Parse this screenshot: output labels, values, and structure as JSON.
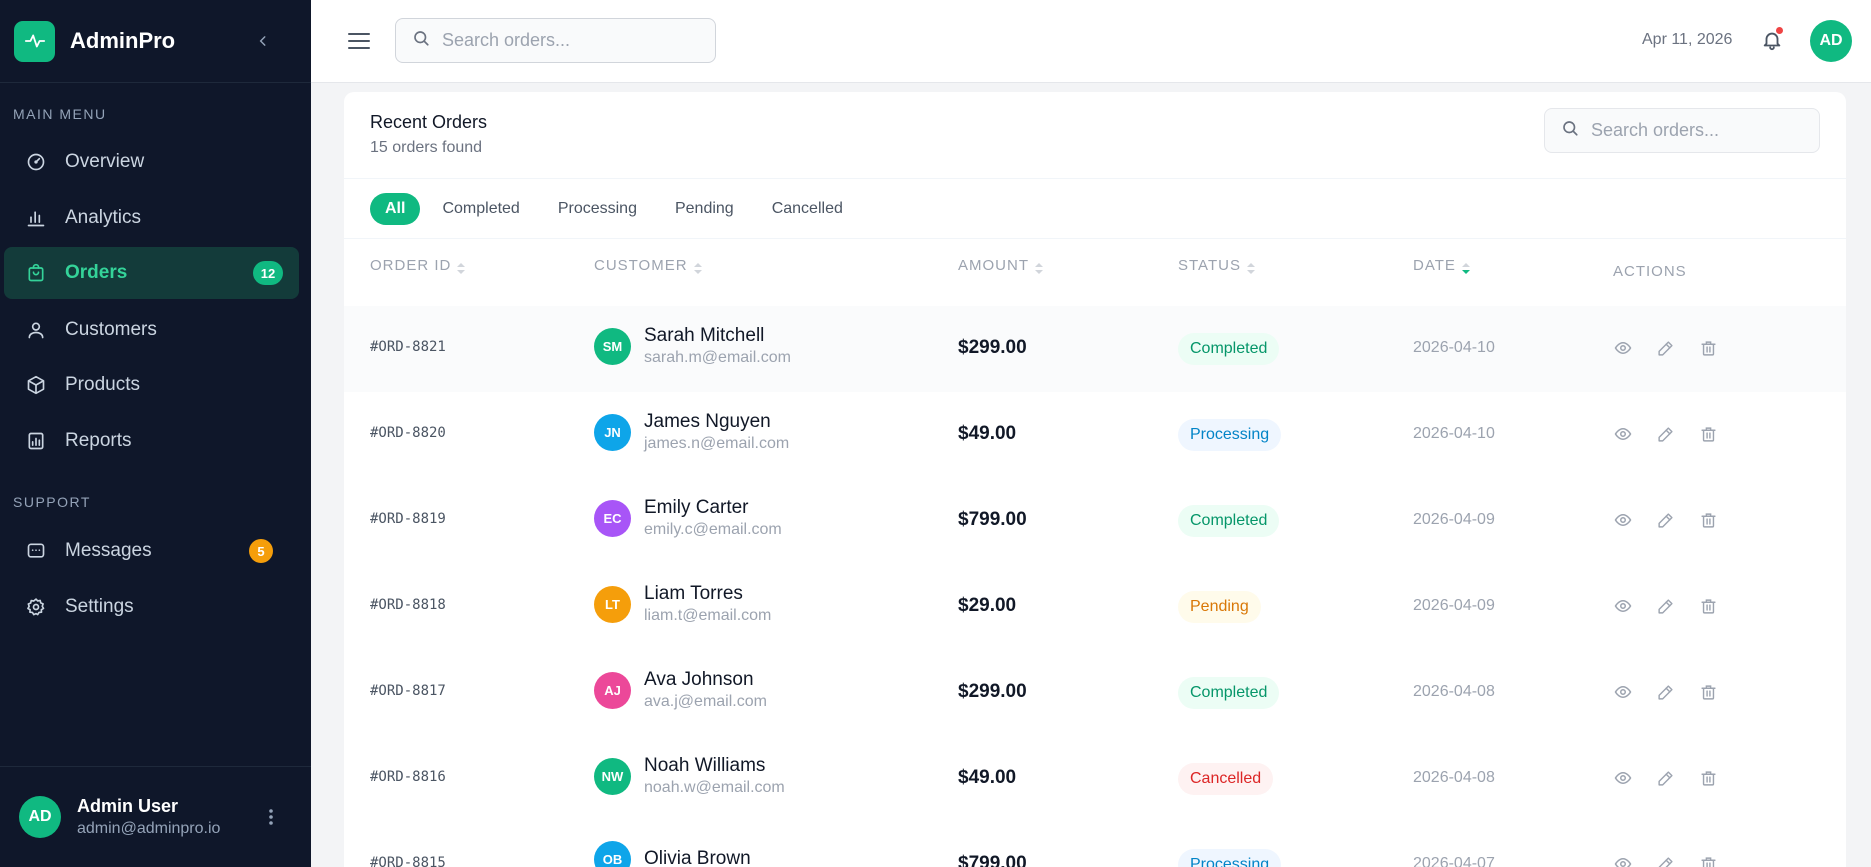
{
  "app": {
    "name": "AdminPro"
  },
  "sidebar": {
    "main_menu_label": "MAIN MENU",
    "support_label": "SUPPORT",
    "items": [
      {
        "label": "Overview",
        "icon": "dashboard-gauge-icon"
      },
      {
        "label": "Analytics",
        "icon": "bar-chart-icon"
      },
      {
        "label": "Orders",
        "icon": "shopping-bag-icon",
        "badge": "12",
        "active": true
      },
      {
        "label": "Customers",
        "icon": "user-icon"
      },
      {
        "label": "Products",
        "icon": "box-icon"
      },
      {
        "label": "Reports",
        "icon": "report-icon"
      }
    ],
    "support_items": [
      {
        "label": "Messages",
        "icon": "message-icon",
        "badge": "5"
      },
      {
        "label": "Settings",
        "icon": "gear-icon"
      }
    ],
    "user": {
      "initials": "AD",
      "name": "Admin User",
      "email": "admin@adminpro.io"
    }
  },
  "topbar": {
    "search_placeholder": "Search orders...",
    "date": "Apr 11, 2026",
    "avatar_initials": "AD"
  },
  "orders": {
    "title": "Recent Orders",
    "subtitle": "15 orders found",
    "search_placeholder": "Search orders...",
    "filters": [
      "All",
      "Completed",
      "Processing",
      "Pending",
      "Cancelled"
    ],
    "active_filter": "All",
    "columns": [
      "ORDER ID",
      "CUSTOMER",
      "AMOUNT",
      "STATUS",
      "DATE",
      "ACTIONS"
    ],
    "rows": [
      {
        "id": "#ORD-8821",
        "initials": "SM",
        "name": "Sarah Mitchell",
        "email": "sarah.m@email.com",
        "amount": "$299.00",
        "status": "Completed",
        "date": "2026-04-10",
        "avatar_color": "#10b981"
      },
      {
        "id": "#ORD-8820",
        "initials": "JN",
        "name": "James Nguyen",
        "email": "james.n@email.com",
        "amount": "$49.00",
        "status": "Processing",
        "date": "2026-04-10",
        "avatar_color": "#0ea5e9"
      },
      {
        "id": "#ORD-8819",
        "initials": "EC",
        "name": "Emily Carter",
        "email": "emily.c@email.com",
        "amount": "$799.00",
        "status": "Completed",
        "date": "2026-04-09",
        "avatar_color": "#a855f7"
      },
      {
        "id": "#ORD-8818",
        "initials": "LT",
        "name": "Liam Torres",
        "email": "liam.t@email.com",
        "amount": "$29.00",
        "status": "Pending",
        "date": "2026-04-09",
        "avatar_color": "#f59e0b"
      },
      {
        "id": "#ORD-8817",
        "initials": "AJ",
        "name": "Ava Johnson",
        "email": "ava.j@email.com",
        "amount": "$299.00",
        "status": "Completed",
        "date": "2026-04-08",
        "avatar_color": "#ec4899"
      },
      {
        "id": "#ORD-8816",
        "initials": "NW",
        "name": "Noah Williams",
        "email": "noah.w@email.com",
        "amount": "$49.00",
        "status": "Cancelled",
        "date": "2026-04-08",
        "avatar_color": "#10b981"
      },
      {
        "id": "#ORD-8815",
        "initials": "OB",
        "name": "Olivia Brown",
        "email": "",
        "amount": "$799.00",
        "status": "Processing",
        "date": "2026-04-07",
        "avatar_color": "#0ea5e9"
      }
    ]
  },
  "colors": {
    "accent": "#10b981",
    "sidebar_bg": "#0f172a",
    "completed": "#059669",
    "processing": "#0284c7",
    "pending": "#d97706",
    "cancelled": "#dc2626"
  }
}
